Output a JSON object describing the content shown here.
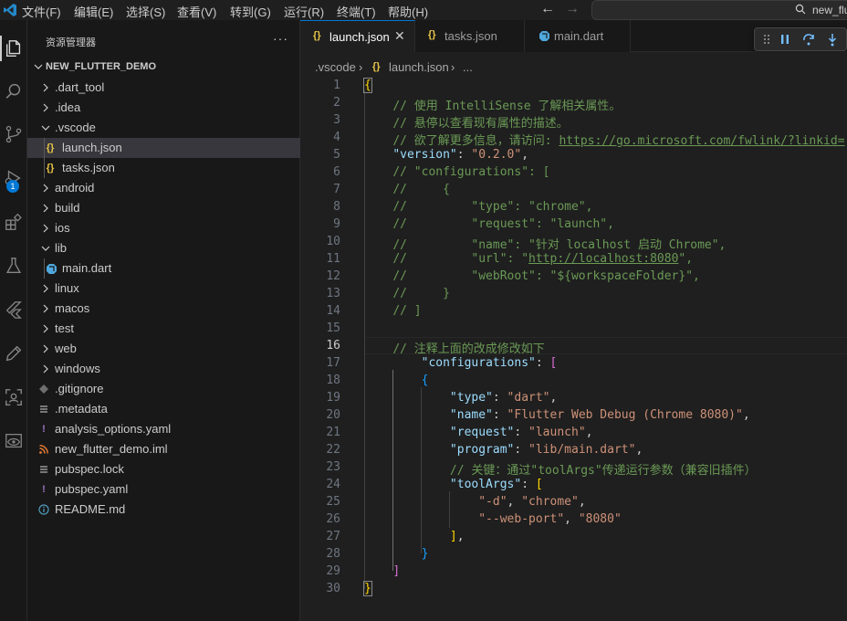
{
  "menu": {
    "items": [
      "文件(F)",
      "编辑(E)",
      "选择(S)",
      "查看(V)",
      "转到(G)",
      "运行(R)",
      "终端(T)",
      "帮助(H)"
    ]
  },
  "command_center": {
    "text": "new_flu"
  },
  "activity_bar": {
    "badge_count": "1",
    "icons": [
      "explorer-icon",
      "search-icon",
      "source-control-icon",
      "run-debug-icon",
      "extensions-icon",
      "testing-icon",
      "flutter-icon",
      "pencil-icon",
      "remote-explorer-icon",
      "preview-icon"
    ]
  },
  "sidebar": {
    "title": "资源管理器",
    "more": "···",
    "folder_name": "NEW_FLUTTER_DEMO",
    "tree": [
      {
        "label": ".dart_tool",
        "kind": "folder",
        "expanded": false,
        "depth": 1
      },
      {
        "label": ".idea",
        "kind": "folder",
        "expanded": false,
        "depth": 1
      },
      {
        "label": ".vscode",
        "kind": "folder",
        "expanded": true,
        "depth": 1
      },
      {
        "label": "launch.json",
        "kind": "json",
        "depth": 2,
        "selected": true
      },
      {
        "label": "tasks.json",
        "kind": "json",
        "depth": 2
      },
      {
        "label": "android",
        "kind": "folder",
        "expanded": false,
        "depth": 1
      },
      {
        "label": "build",
        "kind": "folder",
        "expanded": false,
        "depth": 1
      },
      {
        "label": "ios",
        "kind": "folder",
        "expanded": false,
        "depth": 1
      },
      {
        "label": "lib",
        "kind": "folder",
        "expanded": true,
        "depth": 1
      },
      {
        "label": "main.dart",
        "kind": "dart",
        "depth": 2
      },
      {
        "label": "linux",
        "kind": "folder",
        "expanded": false,
        "depth": 1
      },
      {
        "label": "macos",
        "kind": "folder",
        "expanded": false,
        "depth": 1
      },
      {
        "label": "test",
        "kind": "folder",
        "expanded": false,
        "depth": 1
      },
      {
        "label": "web",
        "kind": "folder",
        "expanded": false,
        "depth": 1
      },
      {
        "label": "windows",
        "kind": "folder",
        "expanded": false,
        "depth": 1
      },
      {
        "label": ".gitignore",
        "kind": "git",
        "depth": 1
      },
      {
        "label": ".metadata",
        "kind": "lines",
        "depth": 1
      },
      {
        "label": "analysis_options.yaml",
        "kind": "yaml",
        "depth": 1
      },
      {
        "label": "new_flutter_demo.iml",
        "kind": "rss",
        "depth": 1
      },
      {
        "label": "pubspec.lock",
        "kind": "lines",
        "depth": 1
      },
      {
        "label": "pubspec.yaml",
        "kind": "yaml",
        "depth": 1
      },
      {
        "label": "README.md",
        "kind": "info",
        "depth": 1
      }
    ]
  },
  "tabs": [
    {
      "icon": "{}",
      "label": "launch.json",
      "active": true,
      "close": "✕"
    },
    {
      "icon": "{}",
      "label": "tasks.json",
      "active": false
    },
    {
      "icon": "dart",
      "label": "main.dart",
      "active": false
    }
  ],
  "breadcrumb": {
    "items": [
      ".vscode",
      "launch.json",
      "..."
    ],
    "separator": "›",
    "file_icon": "{}"
  },
  "editor": {
    "current_line": 16,
    "lines": [
      "{",
      "    // 使用 IntelliSense 了解相关属性。",
      "    // 悬停以查看现有属性的描述。",
      "    // 欲了解更多信息，请访问: https://go.microsoft.com/fwlink/?linkid=",
      "    \"version\": \"0.2.0\",",
      "    // \"configurations\": [",
      "    //     {",
      "    //         \"type\": \"chrome\",",
      "    //         \"request\": \"launch\",",
      "    //         \"name\": \"针对 localhost 启动 Chrome\",",
      "    //         \"url\": \"http://localhost:8080\",",
      "    //         \"webRoot\": \"${workspaceFolder}\",",
      "    //     }",
      "    // ]",
      "",
      "    // 注释上面的改成修改如下",
      "        \"configurations\": [",
      "        {",
      "            \"type\": \"dart\",",
      "            \"name\": \"Flutter Web Debug (Chrome 8080)\",",
      "            \"request\": \"launch\",",
      "            \"program\": \"lib/main.dart\",",
      "            // 关键：通过\"toolArgs\"传递运行参数（兼容旧插件）",
      "            \"toolArgs\": [",
      "                \"-d\", \"chrome\",",
      "                \"--web-port\", \"8080\"",
      "            ],",
      "        }",
      "    ]",
      "}"
    ]
  },
  "colors": {
    "accent": "#0078d4",
    "json_icon": "#e8c547",
    "key": "#9cdcfe",
    "string": "#ce9178",
    "comment": "#6a9955"
  }
}
